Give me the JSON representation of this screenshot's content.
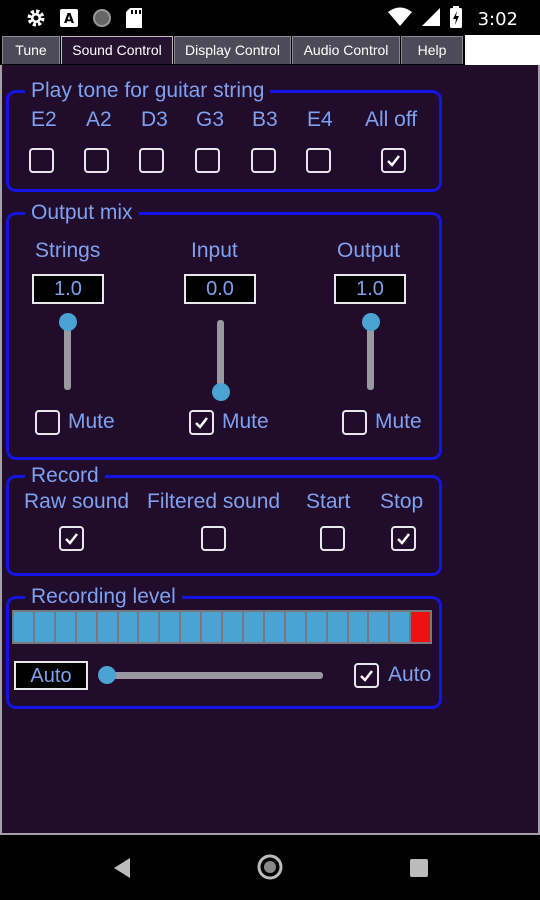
{
  "status_bar": {
    "time": "3:02",
    "icons": [
      "gear-icon",
      "app-a-icon",
      "circle-icon",
      "sd-card-icon",
      "wifi-icon",
      "signal-icon",
      "battery-icon"
    ]
  },
  "tabs": [
    {
      "label": "Tune",
      "active": false
    },
    {
      "label": "Sound Control",
      "active": true
    },
    {
      "label": "Display Control",
      "active": false
    },
    {
      "label": "Audio Control",
      "active": false
    },
    {
      "label": "Help",
      "active": false
    }
  ],
  "play_tone": {
    "title": "Play tone for guitar string",
    "strings": [
      {
        "label": "E2",
        "checked": false
      },
      {
        "label": "A2",
        "checked": false
      },
      {
        "label": "D3",
        "checked": false
      },
      {
        "label": "G3",
        "checked": false
      },
      {
        "label": "B3",
        "checked": false
      },
      {
        "label": "E4",
        "checked": false
      },
      {
        "label": "All off",
        "checked": true
      }
    ]
  },
  "output_mix": {
    "title": "Output mix",
    "channels": [
      {
        "label": "Strings",
        "value": "1.0",
        "level": 1.0,
        "mute_label": "Mute",
        "muted": false
      },
      {
        "label": "Input",
        "value": "0.0",
        "level": 0.0,
        "mute_label": "Mute",
        "muted": true
      },
      {
        "label": "Output",
        "value": "1.0",
        "level": 1.0,
        "mute_label": "Mute",
        "muted": false
      }
    ]
  },
  "record": {
    "title": "Record",
    "options": [
      {
        "label": "Raw sound",
        "checked": true
      },
      {
        "label": "Filtered sound",
        "checked": false
      },
      {
        "label": "Start",
        "checked": false
      },
      {
        "label": "Stop",
        "checked": true
      }
    ]
  },
  "recording_level": {
    "title": "Recording level",
    "meter_segments": 20,
    "hot_segments": 1,
    "auto_box_label": "Auto",
    "slider_level": 0.0,
    "auto_checkbox_label": "Auto",
    "auto_checked": true
  },
  "colors": {
    "background": "#210c2c",
    "group_border": "#1414e6",
    "label_text": "#7fa1ee",
    "slider_knob": "#4aa3d2",
    "meter_hot": "#ee1111"
  },
  "nav_bar": {
    "icons": [
      "back-icon",
      "home-icon",
      "recents-icon"
    ]
  }
}
